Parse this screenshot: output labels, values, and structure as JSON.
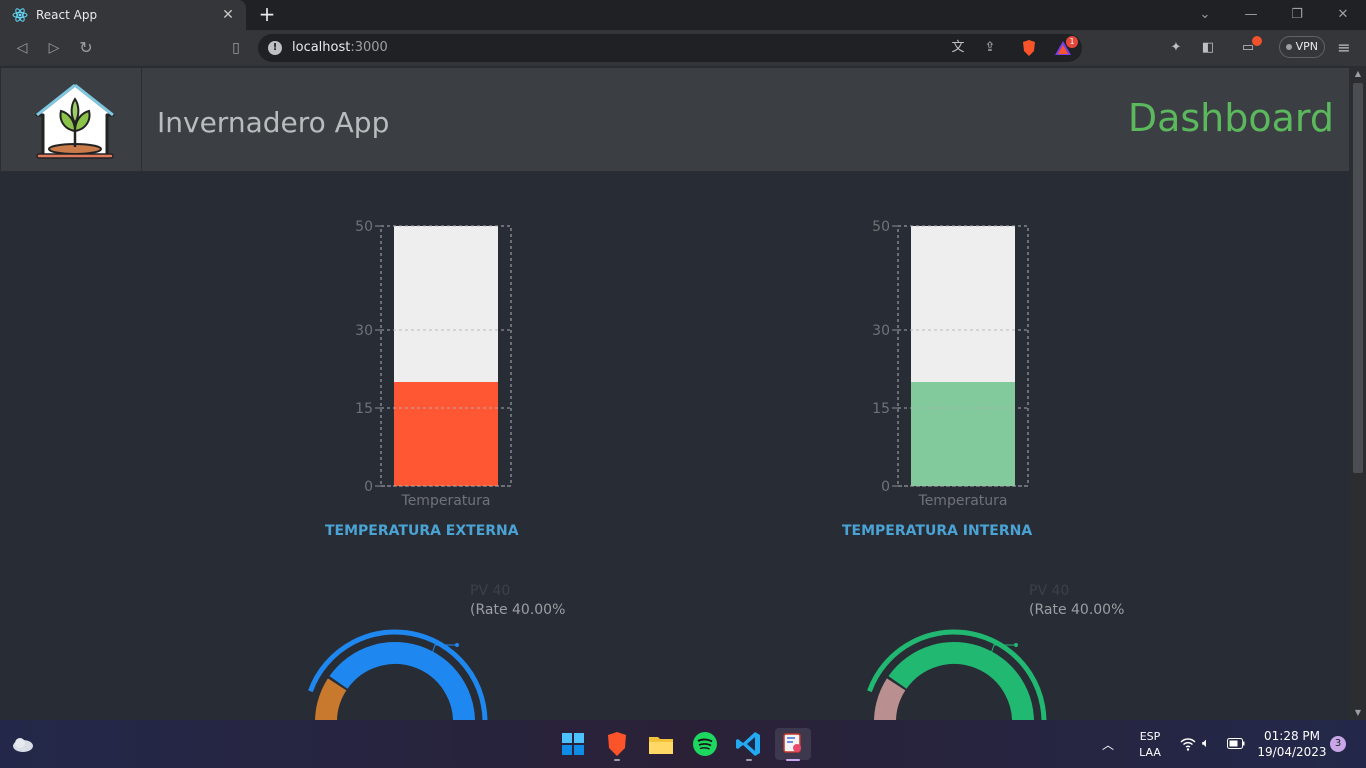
{
  "browser": {
    "tab_title": "React App",
    "url_host": "localhost",
    "url_port": ":3000",
    "vpn_label": "VPN",
    "alert_count": "1"
  },
  "header": {
    "app_title": "Invernadero App",
    "dashboard_title": "Dashboard"
  },
  "charts": [
    {
      "title": "TEMPERATURA EXTERNA",
      "category": "Temperatura",
      "value": 20,
      "max": 50,
      "fill_color": "#ff5733",
      "ticks": [
        "50",
        "30",
        "15",
        "0"
      ]
    },
    {
      "title": "TEMPERATURA INTERNA",
      "category": "Temperatura",
      "value": 20,
      "max": 50,
      "fill_color": "#82c99c",
      "ticks": [
        "50",
        "30",
        "15",
        "0"
      ]
    }
  ],
  "chart_data": [
    {
      "type": "bar",
      "title": "TEMPERATURA EXTERNA",
      "categories": [
        "Temperatura"
      ],
      "values": [
        20
      ],
      "ylim": [
        0,
        50
      ],
      "yticks": [
        0,
        15,
        30,
        50
      ],
      "color": "#ff5733"
    },
    {
      "type": "bar",
      "title": "TEMPERATURA INTERNA",
      "categories": [
        "Temperatura"
      ],
      "values": [
        20
      ],
      "ylim": [
        0,
        50
      ],
      "yticks": [
        0,
        15,
        30,
        50
      ],
      "color": "#82c99c"
    }
  ],
  "gauges": [
    {
      "pv_label": "PV 40",
      "rate_label": "(Rate 40.00%",
      "value_fraction": 0.4,
      "main_color": "#1e88f0",
      "secondary_color": "#c8792d"
    },
    {
      "pv_label": "PV 40",
      "rate_label": "(Rate 40.00%",
      "value_fraction": 0.4,
      "main_color": "#21b871",
      "secondary_color": "#b98f8f"
    }
  ],
  "taskbar": {
    "lang_top": "ESP",
    "lang_bottom": "LAA",
    "time": "01:28 PM",
    "date": "19/04/2023",
    "notification_count": "3"
  }
}
